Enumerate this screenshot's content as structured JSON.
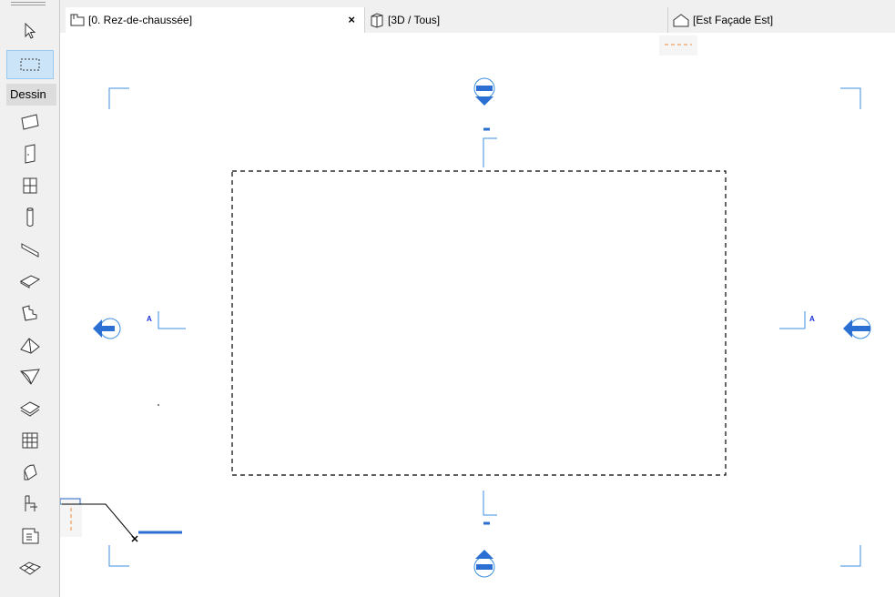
{
  "tabs": [
    {
      "label": "[0. Rez-de-chaussée]",
      "icon": "floor-plan-icon",
      "close": "×",
      "active": true
    },
    {
      "label": "[3D / Tous]",
      "icon": "3d-box-icon",
      "active": false
    },
    {
      "label": "[Est Façade Est]",
      "icon": "elevation-house-icon",
      "active": false
    }
  ],
  "toolbox": {
    "palette_label": "Dessin",
    "tools": [
      {
        "name": "arrow-tool",
        "icon": "cursor-arrow-icon"
      },
      {
        "name": "marquee-tool",
        "icon": "dashed-rectangle-icon",
        "selected": true
      },
      {
        "name": "wall-tool",
        "icon": "wall-icon"
      },
      {
        "name": "door-tool",
        "icon": "door-icon"
      },
      {
        "name": "window-tool",
        "icon": "window-icon"
      },
      {
        "name": "column-tool",
        "icon": "column-icon"
      },
      {
        "name": "beam-tool",
        "icon": "beam-icon"
      },
      {
        "name": "slab-tool",
        "icon": "slab-icon"
      },
      {
        "name": "stair-tool",
        "icon": "stair-icon"
      },
      {
        "name": "roof-tool",
        "icon": "roof-icon"
      },
      {
        "name": "shell-tool",
        "icon": "shell-icon"
      },
      {
        "name": "mesh-tool",
        "icon": "mesh-icon"
      },
      {
        "name": "curtain-wall-tool",
        "icon": "curtain-wall-icon"
      },
      {
        "name": "morph-tool",
        "icon": "morph-icon"
      },
      {
        "name": "object-tool",
        "icon": "chair-icon"
      },
      {
        "name": "zone-tool",
        "icon": "zone-icon"
      },
      {
        "name": "surface-tool",
        "icon": "surface-icon"
      }
    ]
  },
  "canvas": {
    "section_label_left": "A",
    "section_label_right": "A",
    "accent_color": "#3b8de0",
    "marker_fill": "#2a6fd1"
  }
}
